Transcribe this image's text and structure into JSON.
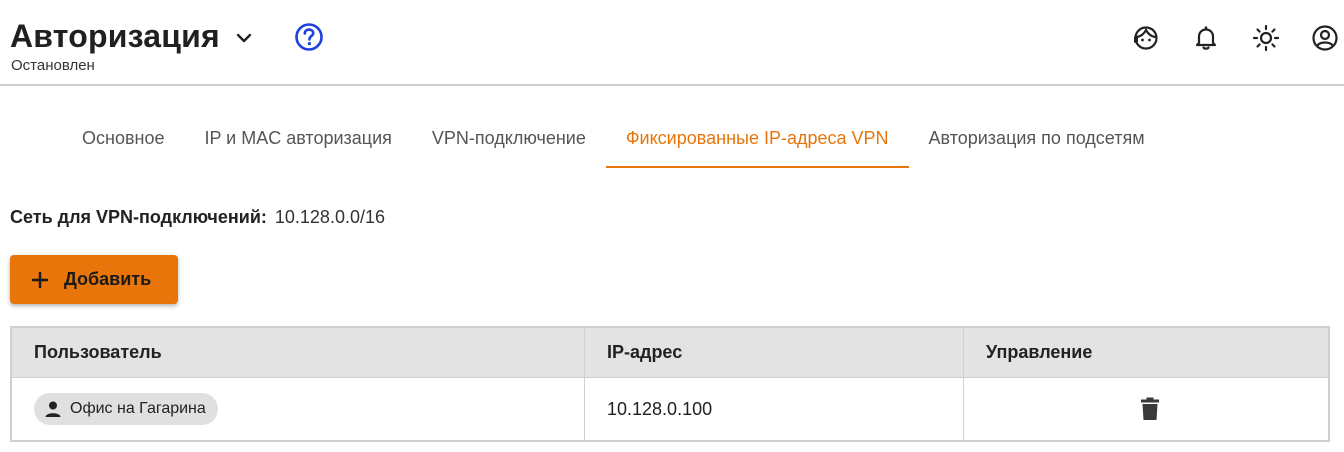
{
  "header": {
    "title": "Авторизация",
    "status": "Остановлен",
    "icons": [
      "chevron-down-icon",
      "help-circle-icon",
      "support-agent-icon",
      "bell-icon",
      "sun-icon",
      "account-circle-icon"
    ]
  },
  "tabs": [
    {
      "label": "Основное",
      "active": false
    },
    {
      "label": "IP и MAC авторизация",
      "active": false
    },
    {
      "label": "VPN-подключение",
      "active": false
    },
    {
      "label": "Фиксированные IP-адреса VPN",
      "active": true
    },
    {
      "label": "Авторизация по подсетям",
      "active": false
    }
  ],
  "vpn_network": {
    "label": "Сеть для VPN-подключений:",
    "value": "10.128.0.0/16"
  },
  "add_button": {
    "label": "Добавить",
    "icon": "plus-icon"
  },
  "table": {
    "columns": [
      "Пользователь",
      "IP-адрес",
      "Управление"
    ],
    "rows": [
      {
        "user": "Офис на Гагарина",
        "ip": "10.128.0.100",
        "action_icon": "trash-icon"
      }
    ]
  },
  "colors": {
    "accent": "#e8750a",
    "help_blue": "#1e40e0",
    "header_bg": "#e3e3e3",
    "chip_bg": "#e0e0e0"
  }
}
